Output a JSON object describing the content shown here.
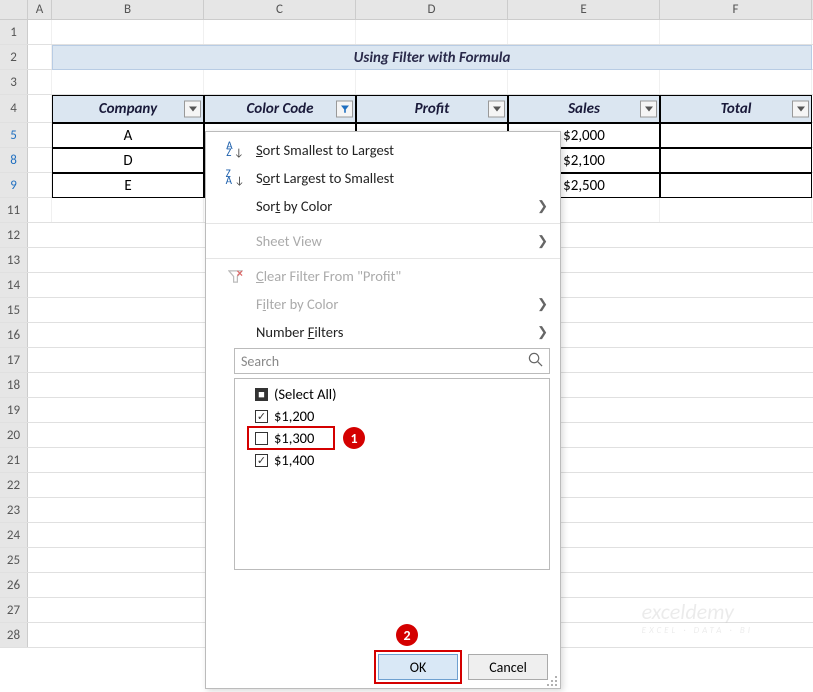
{
  "title": "Using Filter with Formula",
  "columns": [
    "A",
    "B",
    "C",
    "D",
    "E",
    "F"
  ],
  "row_headers": {
    "r1": "1",
    "r2": "2",
    "r3": "3",
    "r4": "4",
    "r5": "5",
    "r8": "8",
    "r9": "9",
    "r11": "11",
    "r12": "12",
    "r13": "13",
    "r14": "14",
    "r15": "15",
    "r16": "16",
    "r17": "17",
    "r18": "18",
    "r19": "19",
    "r20": "20",
    "r21": "21",
    "r22": "22",
    "r23": "23",
    "r24": "24",
    "r25": "25",
    "r26": "26",
    "r27": "27",
    "r28": "28"
  },
  "headers": {
    "company": "Company",
    "color": "Color Code",
    "profit": "Profit",
    "sales": "Sales",
    "total": "Total"
  },
  "data": {
    "company": [
      "A",
      "D",
      "E"
    ],
    "sales": [
      "$2,000",
      "$2,100",
      "$2,500"
    ]
  },
  "menu": {
    "sort_asc": "Sort Smallest to Largest",
    "sort_desc": "Sort Largest to Smallest",
    "sort_color": "Sort by Color",
    "sheet_view": "Sheet View",
    "clear": "Clear Filter From \"Profit\"",
    "filter_color": "Filter by Color",
    "number_filters": "Number Filters",
    "search_placeholder": "Search"
  },
  "checklist": {
    "select_all": "(Select All)",
    "items": [
      "$1,200",
      "$1,300",
      "$1,400"
    ]
  },
  "buttons": {
    "ok": "OK",
    "cancel": "Cancel"
  },
  "badges": {
    "b1": "1",
    "b2": "2"
  },
  "watermark": {
    "main": "exceldemy",
    "sub": "EXCEL · DATA · BI"
  }
}
